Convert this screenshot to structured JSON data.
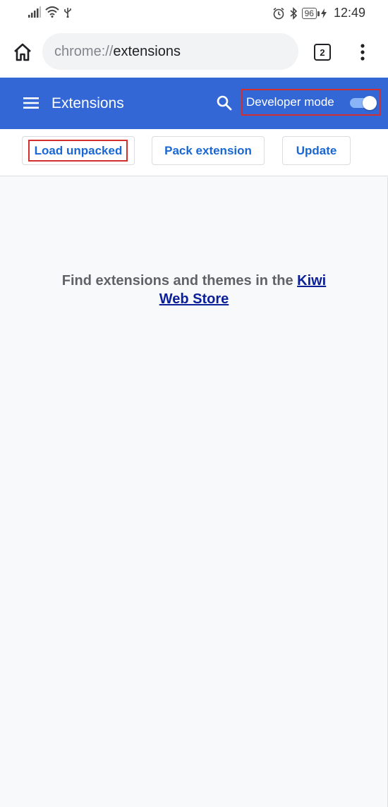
{
  "status_bar": {
    "battery": "96",
    "time": "12:49",
    "icons": [
      "signal-icon",
      "wifi-icon",
      "usb-icon",
      "alarm-icon",
      "bluetooth-icon",
      "battery-icon",
      "charging-icon"
    ]
  },
  "toolbar": {
    "url_scheme": "chrome://",
    "url_host": "extensions",
    "tab_count": "2"
  },
  "header": {
    "title": "Extensions",
    "developer_mode_label": "Developer mode",
    "developer_mode_on": true,
    "color": "#3367d6"
  },
  "actions": {
    "load_unpacked": "Load unpacked",
    "pack_extension": "Pack extension",
    "update": "Update"
  },
  "content": {
    "message": "Find extensions and themes in the ",
    "store_link": "Kiwi Web Store"
  },
  "colors": {
    "highlight": "#d32f2f",
    "accent": "#1967d2"
  }
}
